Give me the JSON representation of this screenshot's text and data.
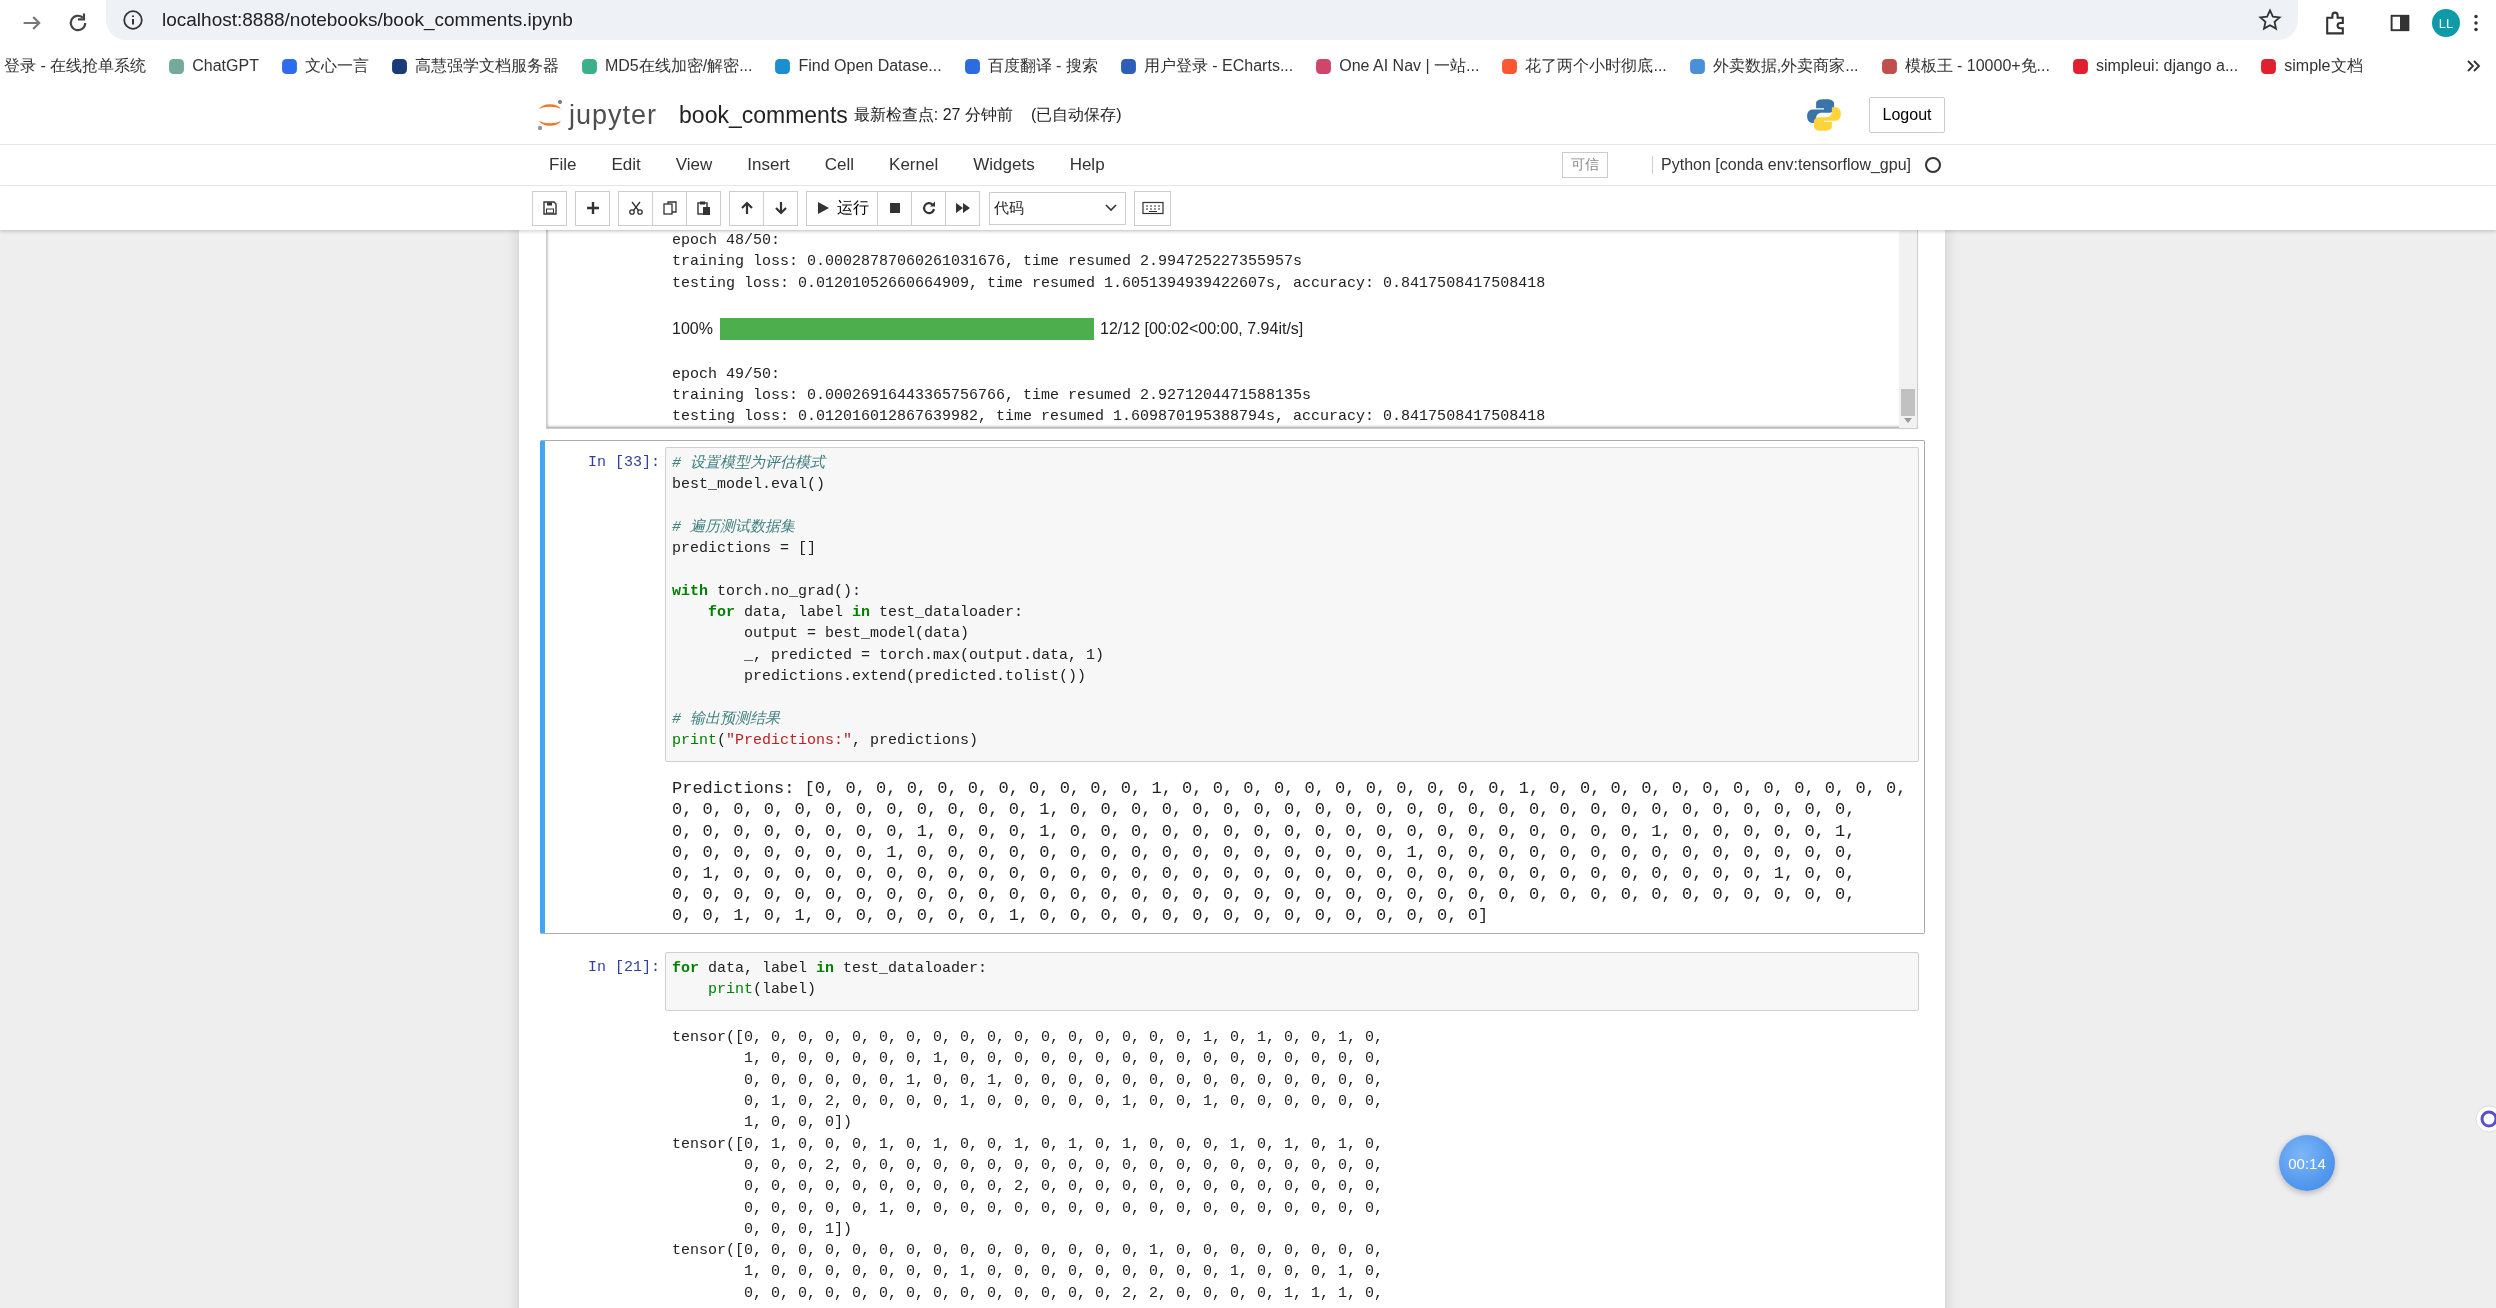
{
  "browser": {
    "url": "localhost:8888/notebooks/book_comments.ipynb",
    "avatar": "LL",
    "bookmarks": [
      {
        "label": "登录 - 在线抢单系统"
      },
      {
        "label": "ChatGPT",
        "color": "#74aa9c"
      },
      {
        "label": "文心一言",
        "color": "#2f6bf0"
      },
      {
        "label": "高慧强学文档服务器",
        "color": "#1a3a7a"
      },
      {
        "label": "MD5在线加密/解密...",
        "color": "#3cb08a"
      },
      {
        "label": "Find Open Datase...",
        "color": "#1c8fd1"
      },
      {
        "label": "百度翻译 - 搜索",
        "color": "#2d6be0"
      },
      {
        "label": "用户登录 - ECharts...",
        "color": "#2e5fb8"
      },
      {
        "label": "One AI Nav | 一站...",
        "color": "#d0466b"
      },
      {
        "label": "花了两个小时彻底...",
        "color": "#fc5531"
      },
      {
        "label": "外卖数据,外卖商家...",
        "color": "#4a90d9"
      },
      {
        "label": "模板王 - 10000+免...",
        "color": "#c0504d"
      },
      {
        "label": "simpleui: django a...",
        "color": "#e0202e"
      },
      {
        "label": "simple文档",
        "color": "#e0202e"
      }
    ]
  },
  "header": {
    "logo_text": "jupyter",
    "notebook_name": "book_comments",
    "checkpoint": "最新检查点: 27 分钟前",
    "autosave": "(已自动保存)",
    "logout": "Logout"
  },
  "menu": {
    "items": [
      "File",
      "Edit",
      "View",
      "Insert",
      "Cell",
      "Kernel",
      "Widgets",
      "Help"
    ],
    "trusted": "可信",
    "kernel": "Python [conda env:tensorflow_gpu]",
    "kernel_busy": false
  },
  "toolbar": {
    "run": "运行",
    "cell_type": "代码"
  },
  "scrolled_output": {
    "items": [
      {
        "kind": "text",
        "lines": [
          "epoch 48/50:",
          "training loss: 0.00028787060261031676, time resumed 2.994725227355957s",
          "testing loss: 0.01201052660664909, time resumed 1.6051394939422607s, accuracy: 0.8417508417508418"
        ]
      },
      {
        "kind": "progress",
        "percent": "100%",
        "level": 1,
        "info": "12/12 [00:02<00:00, 7.94it/s]"
      },
      {
        "kind": "text",
        "lines": [
          "epoch 49/50:",
          "training loss: 0.00026916443365756766, time resumed 2.9271204471588135s",
          "testing loss: 0.012016012867639982, time resumed 1.609870195388794s, accuracy: 0.8417508417508418"
        ]
      }
    ]
  },
  "cells": [
    {
      "prompt": "In [33]:",
      "selected": true,
      "code_blocks": [
        [
          [
            {
              "text": "# 设置模型为评估模式",
              "kind": "comment"
            }
          ],
          [
            {
              "text": "best_model.eval()",
              "kind": "plain"
            }
          ]
        ],
        [
          [
            {
              "text": "# 遍历测试数据集",
              "kind": "comment"
            }
          ],
          [
            {
              "text": "predictions = []",
              "kind": "plain"
            }
          ]
        ],
        [
          [
            {
              "text": "with",
              "kind": "keyword"
            },
            {
              "text": " torch.no_grad():",
              "kind": "plain"
            }
          ],
          [
            {
              "text": "    for",
              "kind": "keyword"
            },
            {
              "text": " data, label ",
              "kind": "plain"
            },
            {
              "text": "in",
              "kind": "keyword"
            },
            {
              "text": " test_dataloader:",
              "kind": "plain"
            }
          ],
          [
            {
              "text": "        output = best_model(data)",
              "kind": "plain"
            }
          ],
          [
            {
              "text": "        _, predicted = torch.max(output.data, 1)",
              "kind": "plain"
            }
          ],
          [
            {
              "text": "        predictions.extend(predicted.tolist())",
              "kind": "plain"
            }
          ]
        ],
        [
          [
            {
              "text": "# 输出预测结果",
              "kind": "comment"
            }
          ],
          [
            {
              "text": "print",
              "kind": "builtin"
            },
            {
              "text": "(",
              "kind": "plain"
            },
            {
              "text": "\"Predictions:\"",
              "kind": "string"
            },
            {
              "text": ", predictions)",
              "kind": "plain"
            }
          ]
        ]
      ],
      "output": {
        "kind": "list",
        "lines": [
          "Predictions: [0, 0, 0, 0, 0, 0, 0, 0, 0, 0, 0, 1, 0, 0, 0, 0, 0, 0, 0, 0, 0, 0, 0, 1, 0, 0, 0, 0, 0, 0, 0, 0, 0, 0, 0, 0,",
          "0, 0, 0, 0, 0, 0, 0, 0, 0, 0, 0, 0, 1, 0, 0, 0, 0, 0, 0, 0, 0, 0, 0, 0, 0, 0, 0, 0, 0, 0, 0, 0, 0, 0, 0, 0, 0, 0, 0,",
          "0, 0, 0, 0, 0, 0, 0, 0, 1, 0, 0, 0, 1, 0, 0, 0, 0, 0, 0, 0, 0, 0, 0, 0, 0, 0, 0, 0, 0, 0, 0, 0, 1, 0, 0, 0, 0, 0, 1,",
          "0, 0, 0, 0, 0, 0, 0, 1, 0, 0, 0, 0, 0, 0, 0, 0, 0, 0, 0, 0, 0, 0, 0, 0, 1, 0, 0, 0, 0, 0, 0, 0, 0, 0, 0, 0, 0, 0, 0,",
          "0, 1, 0, 0, 0, 0, 0, 0, 0, 0, 0, 0, 0, 0, 0, 0, 0, 0, 0, 0, 0, 0, 0, 0, 0, 0, 0, 0, 0, 0, 0, 0, 0, 0, 0, 0, 1, 0, 0,",
          "0, 0, 0, 0, 0, 0, 0, 0, 0, 0, 0, 0, 0, 0, 0, 0, 0, 0, 0, 0, 0, 0, 0, 0, 0, 0, 0, 0, 0, 0, 0, 0, 0, 0, 0, 0, 0, 0, 0,",
          "0, 0, 1, 0, 1, 0, 0, 0, 0, 0, 0, 1, 0, 0, 0, 0, 0, 0, 0, 0, 0, 0, 0, 0, 0, 0, 0]"
        ]
      }
    },
    {
      "prompt": "In [21]:",
      "selected": false,
      "code_blocks": [
        [
          [
            {
              "text": "for",
              "kind": "keyword"
            },
            {
              "text": " data, label ",
              "kind": "plain"
            },
            {
              "text": "in",
              "kind": "keyword"
            },
            {
              "text": " test_dataloader:",
              "kind": "plain"
            }
          ],
          [
            {
              "text": "    print",
              "kind": "builtin"
            },
            {
              "text": "(label)",
              "kind": "plain"
            }
          ]
        ]
      ],
      "output": {
        "kind": "tensors",
        "tensors": [
          {
            "lines": [
              "tensor([0, 0, 0, 0, 0, 0, 0, 0, 0, 0, 0, 0, 0, 0, 0, 0, 0, 1, 0, 1, 0, 0, 1, 0,",
              "1, 0, 0, 0, 0, 0, 0, 1, 0, 0, 0, 0, 0, 0, 0, 0, 0, 0, 0, 0, 0, 0, 0, 0,",
              "0, 0, 0, 0, 0, 0, 1, 0, 0, 1, 0, 0, 0, 0, 0, 0, 0, 0, 0, 0, 0, 0, 0, 0,",
              "0, 1, 0, 2, 0, 0, 0, 0, 1, 0, 0, 0, 0, 0, 1, 0, 0, 1, 0, 0, 0, 0, 0, 0,",
              "1, 0, 0, 0])"
            ]
          },
          {
            "lines": [
              "tensor([0, 1, 0, 0, 0, 1, 0, 1, 0, 0, 1, 0, 1, 0, 1, 0, 0, 0, 1, 0, 1, 0, 1, 0,",
              "0, 0, 0, 2, 0, 0, 0, 0, 0, 0, 0, 0, 0, 0, 0, 0, 0, 0, 0, 0, 0, 0, 0, 0,",
              "0, 0, 0, 0, 0, 0, 0, 0, 0, 0, 2, 0, 0, 0, 0, 0, 0, 0, 0, 0, 0, 0, 0, 0,",
              "0, 0, 0, 0, 0, 1, 0, 0, 0, 0, 0, 0, 0, 0, 0, 0, 0, 0, 0, 0, 0, 0, 0, 0,",
              "0, 0, 0, 1])"
            ]
          },
          {
            "lines": [
              "tensor([0, 0, 0, 0, 0, 0, 0, 0, 0, 0, 0, 0, 0, 0, 0, 1, 0, 0, 0, 0, 0, 0, 0, 0,",
              "1, 0, 0, 0, 0, 0, 0, 0, 1, 0, 0, 0, 0, 0, 0, 0, 0, 0, 1, 0, 0, 0, 1, 0,",
              "0, 0, 0, 0, 0, 0, 0, 0, 0, 0, 0, 0, 0, 0, 2, 2, 0, 0, 0, 0, 1, 1, 1, 0,"
            ]
          }
        ]
      }
    }
  ],
  "timer": "00:14"
}
